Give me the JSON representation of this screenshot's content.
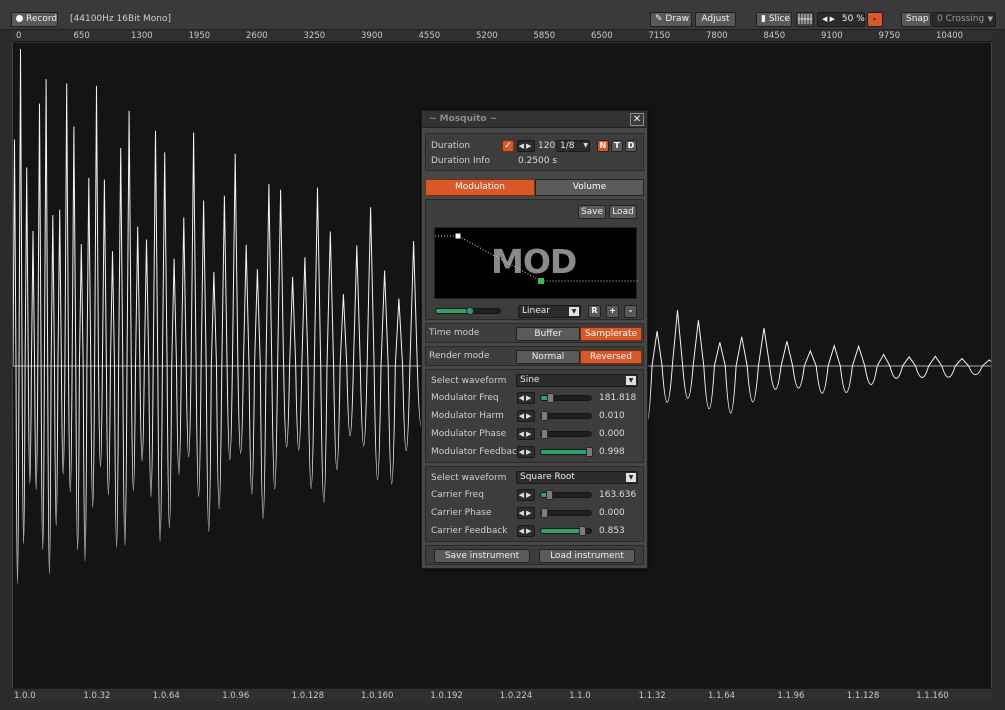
{
  "toolbar": {
    "record_label": "Record",
    "format_info": "[44100Hz 16Bit Mono]",
    "draw_label": "Draw",
    "adjust_label": "Adjust",
    "slice_label": "Slice",
    "zoom_value": "50 %",
    "snap_label": "Snap",
    "crossing_label": "0 Crossing"
  },
  "ruler_top": [
    "0",
    "650",
    "1300",
    "1950",
    "2600",
    "3250",
    "3900",
    "4550",
    "5200",
    "5850",
    "6500",
    "7150",
    "7800",
    "8450",
    "9100",
    "9750",
    "10400"
  ],
  "ruler_bottom": [
    "1.0.0",
    "1.0.32",
    "1.0.64",
    "1.0.96",
    "1.0.128",
    "1.0.160",
    "1.0.192",
    "1.0.224",
    "1.1.0",
    "1.1.32",
    "1.1.64",
    "1.1.96",
    "1.1.128",
    "1.1.160"
  ],
  "plugin": {
    "title": "~ Mosquito ~",
    "duration_label": "Duration",
    "duration_value": "120",
    "duration_fraction": "1/8",
    "ntd": [
      "N",
      "T",
      "D"
    ],
    "duration_info_label": "Duration Info",
    "duration_info_value": "0.2500 s",
    "tab_modulation": "Modulation",
    "tab_volume": "Volume",
    "save_label": "Save",
    "load_label": "Load",
    "mod_display_text": "MOD",
    "interp_value": "Linear",
    "btn_r": "R",
    "btn_plus": "+",
    "btn_minus": "-",
    "time_mode_label": "Time mode",
    "time_mode_buffer": "Buffer",
    "time_mode_samplerate": "Samplerate",
    "render_mode_label": "Render mode",
    "render_mode_normal": "Normal",
    "render_mode_reversed": "Reversed",
    "modulator": {
      "select_label": "Select waveform",
      "waveform": "Sine",
      "rows": [
        {
          "label": "Modulator Freq",
          "value": "181.818",
          "level": 0.13
        },
        {
          "label": "Modulator Harm",
          "value": "0.010",
          "level": 0.01
        },
        {
          "label": "Modulator Phase",
          "value": "0.000",
          "level": 0.0
        },
        {
          "label": "Modulator Feedback",
          "value": "0.998",
          "level": 0.998
        }
      ]
    },
    "carrier": {
      "select_label": "Select waveform",
      "waveform": "Square Root",
      "rows": [
        {
          "label": "Carrier Freq",
          "value": "163.636",
          "level": 0.11
        },
        {
          "label": "Carrier Phase",
          "value": "0.000",
          "level": 0.0
        },
        {
          "label": "Carrier Feedback",
          "value": "0.853",
          "level": 0.853
        }
      ]
    },
    "save_instrument": "Save instrument",
    "load_instrument": "Load instrument"
  },
  "colors": {
    "accent": "#d9582a",
    "slider_fill": "#2fa36b",
    "wave": "#f2f2f2",
    "background": "#141414"
  }
}
